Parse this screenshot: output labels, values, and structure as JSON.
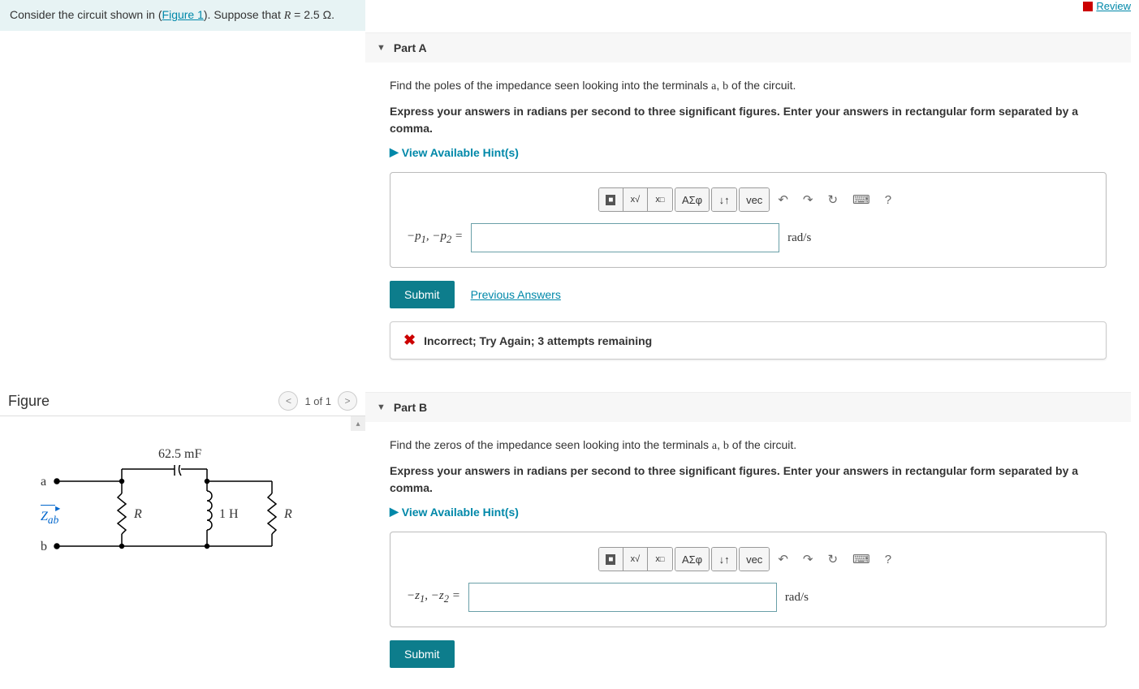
{
  "problem": {
    "text_before": "Consider the circuit shown in (",
    "figure_link": "Figure 1",
    "text_after": "). Suppose that ",
    "variable": "R",
    "value": " = 2.5 Ω."
  },
  "review_link": "Review",
  "figure": {
    "title": "Figure",
    "counter": "1 of 1",
    "labels": {
      "capacitor": "62.5 mF",
      "terminal_a": "a",
      "terminal_b": "b",
      "zab": "Z",
      "zab_sub": "ab",
      "r1": "R",
      "inductor": "1 H",
      "r2": "R"
    }
  },
  "partA": {
    "title": "Part A",
    "instruction1": "Find the poles of the impedance seen looking into the terminals a, b of the circuit.",
    "instruction2": "Express your answers in radians per second to three significant figures. Enter your answers in rectangular form separated by a comma.",
    "hints_label": "View Available Hint(s)",
    "toolbar": {
      "templates": "■",
      "fraction": "√",
      "sub": "□",
      "greek": "ΑΣφ",
      "arrows": "↓↑",
      "vec": "vec",
      "undo": "↶",
      "redo": "↷",
      "reset": "↻",
      "keyboard": "⌨",
      "help": "?"
    },
    "answer_label_prefix": "−",
    "answer_var1": "p",
    "answer_sub1": "1",
    "answer_sep": ", −",
    "answer_var2": "p",
    "answer_sub2": "2",
    "answer_eq": " =",
    "unit": "rad/s",
    "submit": "Submit",
    "prev_answers": "Previous Answers",
    "feedback": "Incorrect; Try Again; 3 attempts remaining"
  },
  "partB": {
    "title": "Part B",
    "instruction1": "Find the zeros of the impedance seen looking into the terminals a, b of the circuit.",
    "instruction2": "Express your answers in radians per second to three significant figures. Enter your answers in rectangular form separated by a comma.",
    "hints_label": "View Available Hint(s)",
    "answer_label_prefix": "−",
    "answer_var1": "z",
    "answer_sub1": "1",
    "answer_sep": ", −",
    "answer_var2": "z",
    "answer_sub2": "2",
    "answer_eq": " =",
    "unit": "rad/s",
    "submit": "Submit"
  }
}
